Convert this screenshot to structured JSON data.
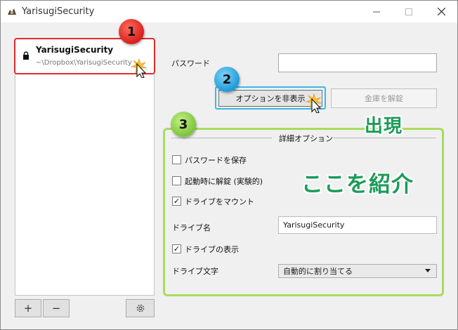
{
  "window": {
    "title": "YarisugiSecurity",
    "icon": "app-logo-icon",
    "controls": [
      "minimize-icon",
      "maximize-icon",
      "close-icon"
    ]
  },
  "sidebar": {
    "items": [
      {
        "name": "YarisugiSecurity",
        "path": "~\\Dropbox\\YarisugiSecurity",
        "icon": "lock-icon"
      }
    ],
    "add_label": "+",
    "remove_label": "−",
    "settings_icon": "gear-icon"
  },
  "main": {
    "password_label": "パスワード",
    "password_value": "",
    "toggle_options_label": "オプションを非表示",
    "unlock_label": "金庫を解錠",
    "details": {
      "title": "詳細オプション",
      "save_password": {
        "label": "パスワードを保存",
        "checked": false
      },
      "auto_unlock": {
        "label": "起動時に解錠 (実験的)",
        "checked": false
      },
      "mount_drive": {
        "label": "ドライブをマウント",
        "checked": true
      },
      "drive_name_label": "ドライブ名",
      "drive_name_value": "YarisugiSecurity",
      "show_drive": {
        "label": "ドライブの表示",
        "checked": true
      },
      "drive_letter_label": "ドライブ文字",
      "drive_letter_value": "自動的に割り当てる"
    }
  },
  "annotations": {
    "badges": [
      "1",
      "2",
      "3"
    ],
    "appear_text": "出現",
    "intro_text": "ここを紹介",
    "colors": {
      "badge1": "#e02b2b",
      "badge2": "#1f9bd9",
      "badge3": "#7cc53a",
      "callout": "#1c9c57"
    }
  }
}
